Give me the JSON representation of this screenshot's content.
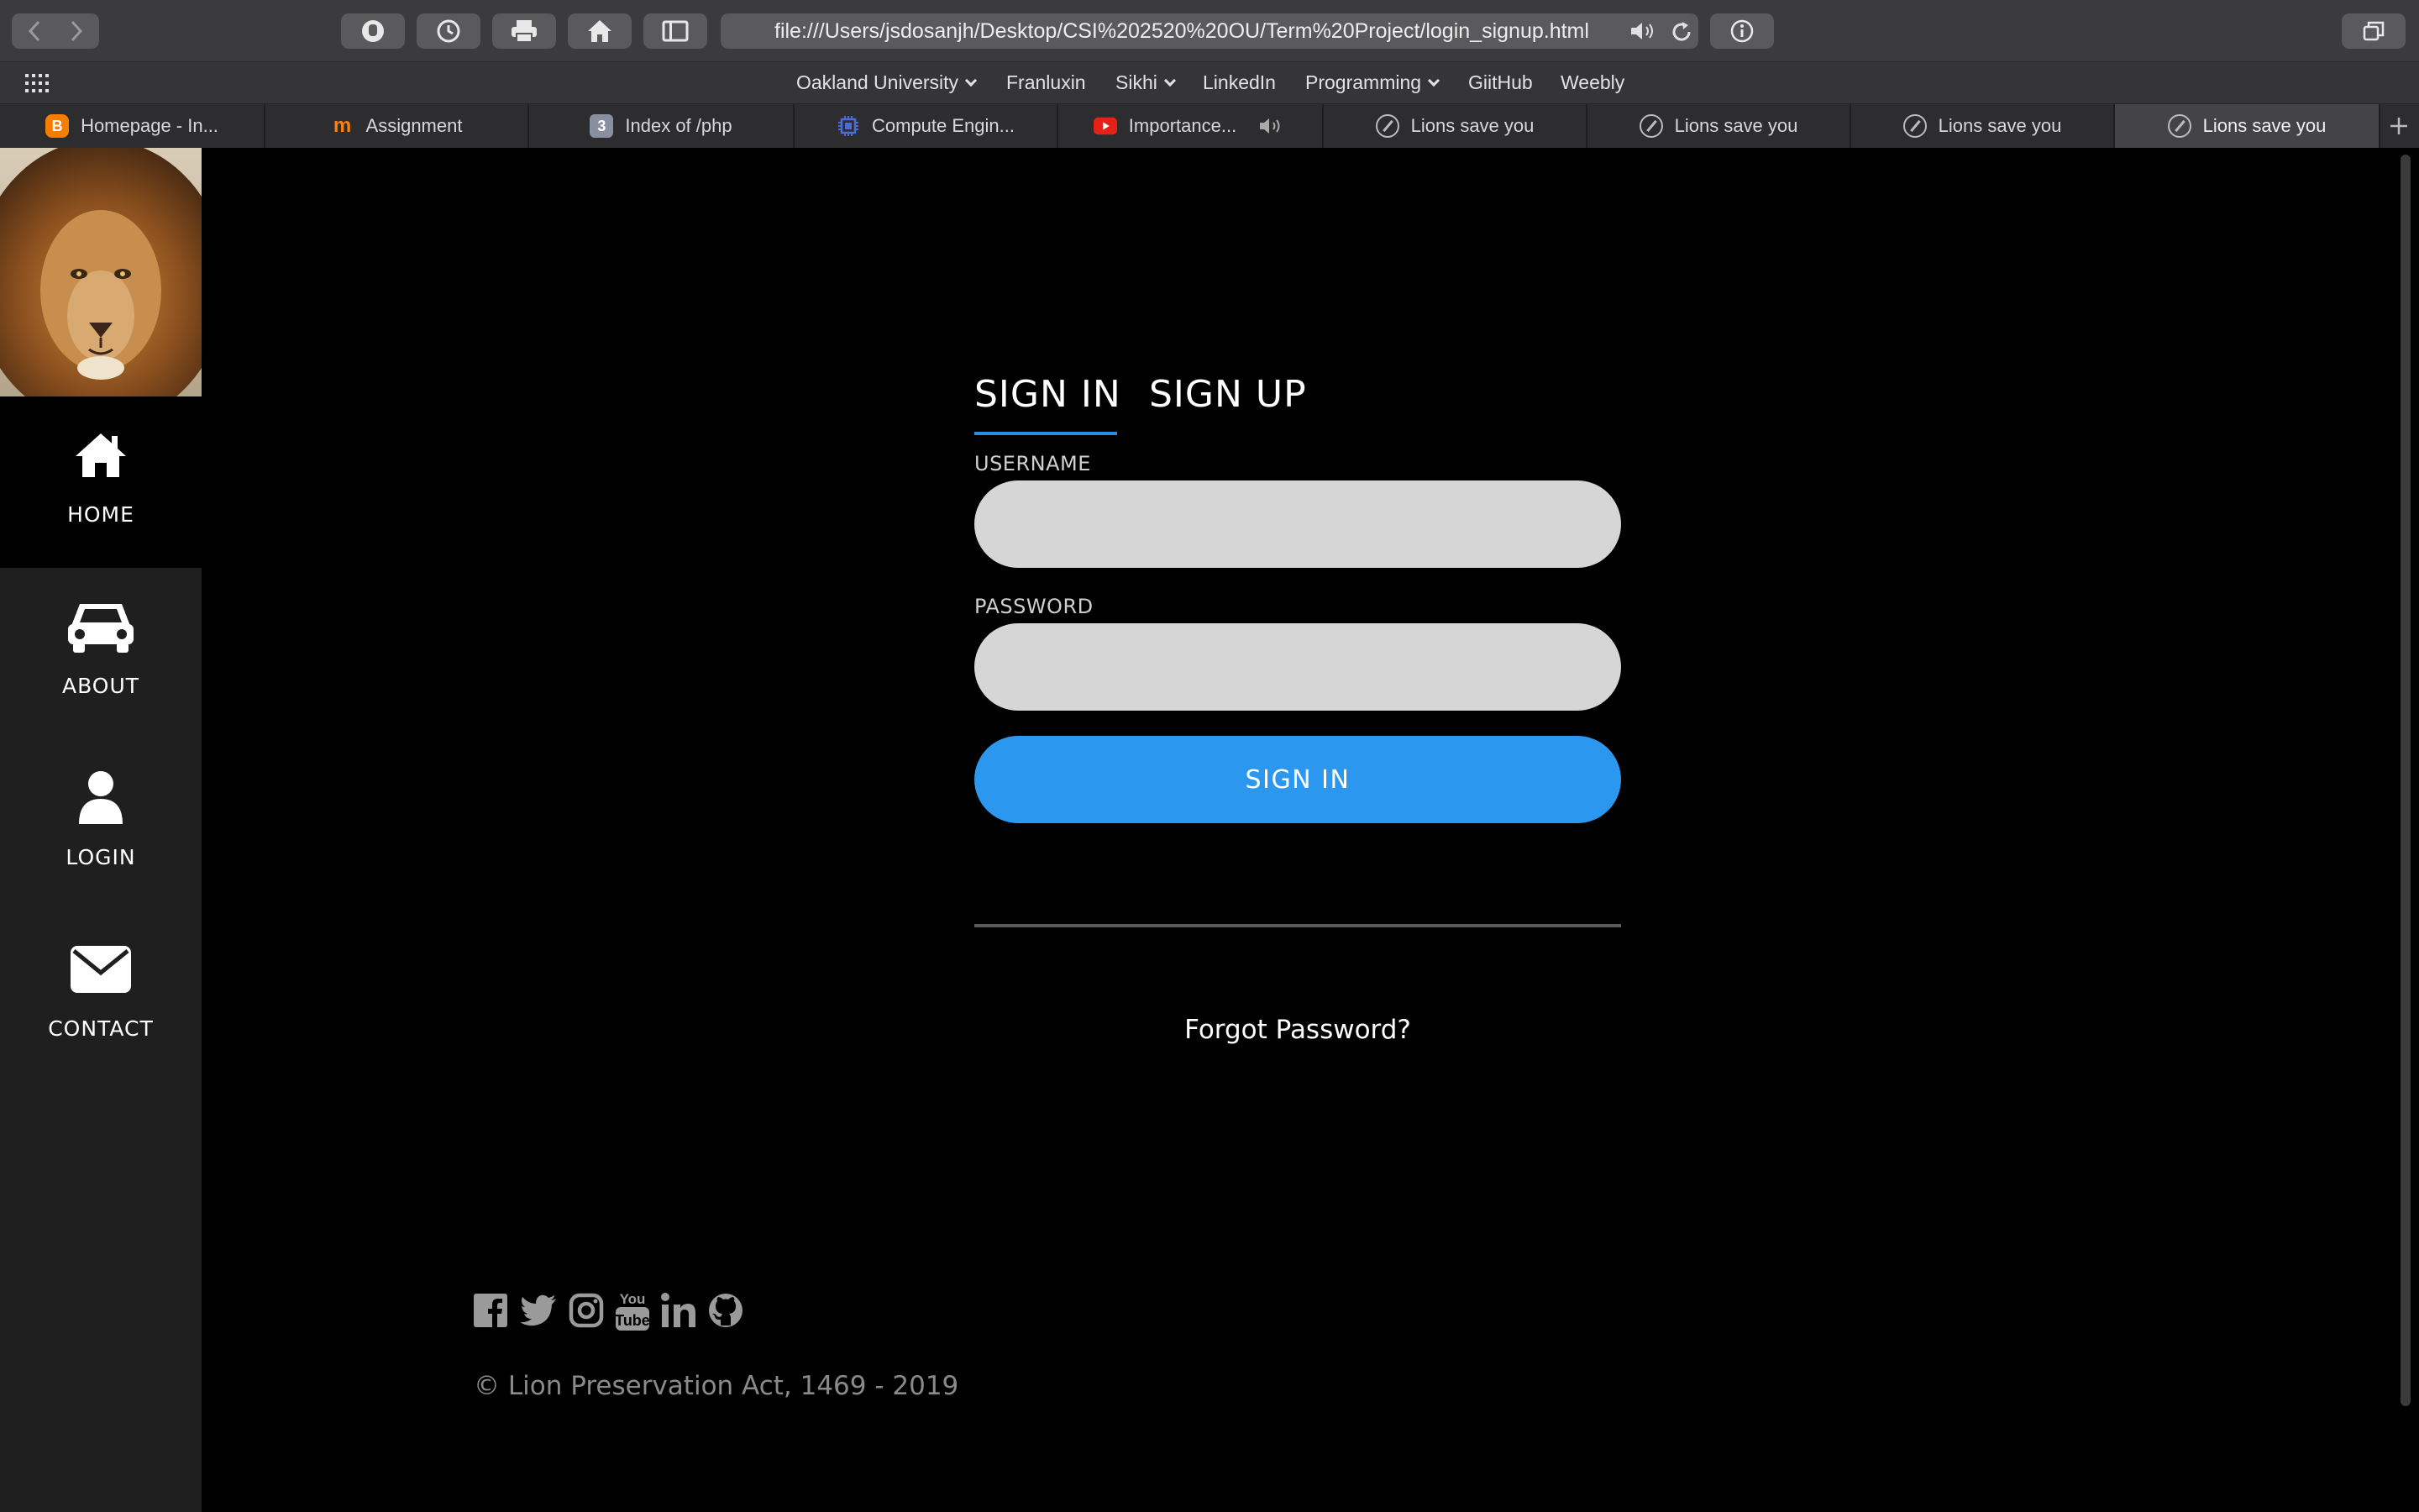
{
  "browser": {
    "address": "file:///Users/jsdosanjh/Desktop/CSI%202520%20OU/Term%20Project/login_signup.html",
    "favorites": [
      {
        "label": "Oakland University",
        "has_menu": true
      },
      {
        "label": "Franluxin",
        "has_menu": false
      },
      {
        "label": "Sikhi",
        "has_menu": true
      },
      {
        "label": "LinkedIn",
        "has_menu": false
      },
      {
        "label": "Programming",
        "has_menu": true
      },
      {
        "label": "GiitHub",
        "has_menu": false
      },
      {
        "label": "Weebly",
        "has_menu": false
      }
    ],
    "tabs": [
      {
        "label": "Homepage - In...",
        "icon": "blogger-icon",
        "favicon_text": "B",
        "favicon_color": "#f57d00"
      },
      {
        "label": "Assignment",
        "icon": "moodle-icon",
        "favicon_text": "m",
        "favicon_color": "#f98012"
      },
      {
        "label": "Index of /php",
        "icon": "number-badge-icon",
        "favicon_text": "3",
        "favicon_color": "#8a8fa0"
      },
      {
        "label": "Compute Engin...",
        "icon": "chip-icon",
        "favicon_text": "",
        "favicon_color": "#4a6bd8"
      },
      {
        "label": "Importance...",
        "icon": "youtube-icon",
        "favicon_text": "",
        "favicon_color": "#e62117"
      },
      {
        "label": "Lions save you",
        "icon": "compass-icon"
      },
      {
        "label": "Lions save you",
        "icon": "compass-icon"
      },
      {
        "label": "Lions save you",
        "icon": "compass-icon"
      },
      {
        "label": "Lions save you",
        "icon": "compass-icon",
        "active": true
      }
    ]
  },
  "sidebar": {
    "items": [
      {
        "label": "HOME",
        "icon": "home-icon",
        "active": true
      },
      {
        "label": "ABOUT",
        "icon": "car-icon"
      },
      {
        "label": "LOGIN",
        "icon": "user-icon"
      },
      {
        "label": "CONTACT",
        "icon": "envelope-icon"
      }
    ]
  },
  "form": {
    "tab_signin": "SIGN IN",
    "tab_signup": "SIGN UP",
    "username_label": "USERNAME",
    "username_value": "",
    "password_label": "PASSWORD",
    "password_value": "",
    "submit_label": "SIGN IN",
    "forgot_label": "Forgot Password?"
  },
  "footer": {
    "social_icons": [
      "facebook-icon",
      "twitter-icon",
      "instagram-icon",
      "youtube-icon",
      "linkedin-icon",
      "github-icon"
    ],
    "copyright": "© Lion Preservation Act, 1469 - 2019"
  },
  "colors": {
    "accent": "#2b97ee",
    "sidebar_bg": "#1f1f1f",
    "page_bg": "#000000",
    "input_bg": "#d6d6d6"
  }
}
